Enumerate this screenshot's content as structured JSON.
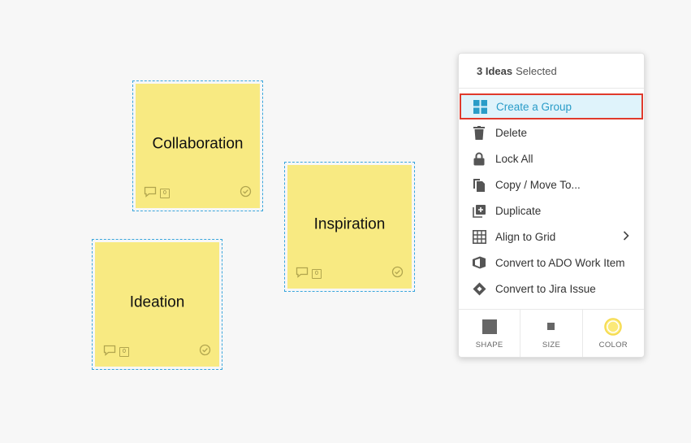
{
  "notes": [
    {
      "text": "Collaboration",
      "comment_count": "0"
    },
    {
      "text": "Inspiration",
      "comment_count": "0"
    },
    {
      "text": "Ideation",
      "comment_count": "0"
    }
  ],
  "menu": {
    "header_count": "3 Ideas",
    "header_suffix": "Selected",
    "items": [
      {
        "label": "Create a Group",
        "icon": "group-grid-icon"
      },
      {
        "label": "Delete",
        "icon": "trash-icon"
      },
      {
        "label": "Lock All",
        "icon": "lock-icon"
      },
      {
        "label": "Copy / Move To...",
        "icon": "copy-icon"
      },
      {
        "label": "Duplicate",
        "icon": "duplicate-icon"
      },
      {
        "label": "Align to Grid",
        "icon": "grid-icon"
      },
      {
        "label": "Convert to ADO Work Item",
        "icon": "ado-icon"
      },
      {
        "label": "Convert to Jira Issue",
        "icon": "jira-icon"
      }
    ],
    "footer": [
      {
        "label": "SHAPE",
        "icon": "square-icon"
      },
      {
        "label": "SIZE",
        "icon": "small-square-icon"
      },
      {
        "label": "COLOR",
        "icon": "color-circle-icon"
      }
    ]
  },
  "colors": {
    "note_fill": "#f8ea82",
    "selection_border": "#3aa6dd",
    "highlight_bg": "#dff3fb",
    "highlight_text": "#2a9cc8",
    "highlight_outline": "#e03a2c",
    "color_swatch": "#fbe978"
  }
}
